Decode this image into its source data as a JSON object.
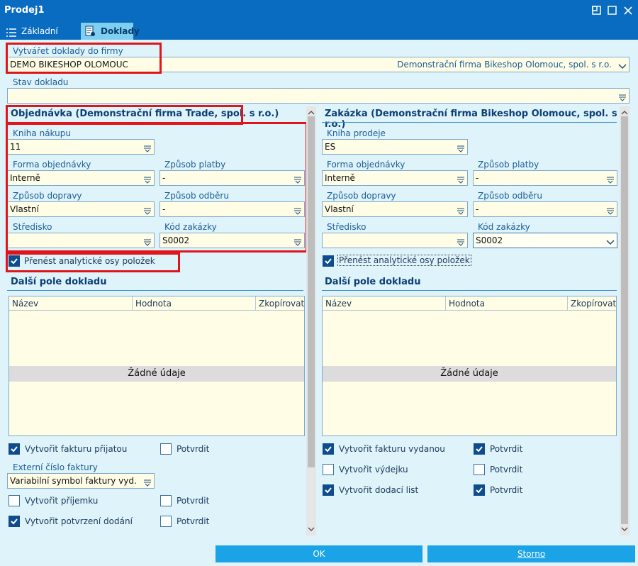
{
  "window": {
    "title": "Prodej1"
  },
  "tabs": [
    {
      "label": "Základní údaje"
    },
    {
      "label": "Doklady"
    }
  ],
  "firm": {
    "label": "Vytvářet doklady do firmy",
    "value": "DEMO BIKESHOP OLOMOUC",
    "display": "Demonstrační firma Bikeshop Olomouc, spol. s r.o."
  },
  "status": {
    "label": "Stav dokladu",
    "value": ""
  },
  "left": {
    "title": "Objednávka (Demonstrační firma Trade, spol. s r.o.)",
    "book_label": "Kniha nákupu",
    "book_value": "11",
    "form_label": "Forma objednávky",
    "form_value": "Interně",
    "payment_label": "Způsob platby",
    "payment_value": "-",
    "transport_label": "Způsob dopravy",
    "transport_value": "Vlastní",
    "pickup_label": "Způsob odběru",
    "pickup_value": "-",
    "center_label": "Středisko",
    "center_value": "",
    "order_code_label": "Kód zakázky",
    "order_code_value": "S0002",
    "transfer_label": "Přenést analytické osy položek",
    "more_title": "Další pole dokladu",
    "col_name": "Název",
    "col_value": "Hodnota",
    "col_copy": "Zkopírovat",
    "no_data": "Žádné údaje",
    "create_invoice": "Vytvořit fakturu přijatou",
    "confirm1": "Potvrdit",
    "ext_label": "Externí číslo faktury",
    "ext_value": "Variabilní symbol faktury vyd.",
    "create_receipt": "Vytvořit příjemku",
    "confirm2": "Potvrdit",
    "create_delivery_confirm": "Vytvořit potvrzení dodání",
    "confirm3": "Potvrdit"
  },
  "right": {
    "title": "Zakázka (Demonstrační firma Bikeshop Olomouc, spol. s r.o.)",
    "book_label": "Kniha prodeje",
    "book_value": "ES",
    "form_label": "Forma objednávky",
    "form_value": "Interně",
    "payment_label": "Způsob platby",
    "payment_value": "-",
    "transport_label": "Způsob dopravy",
    "transport_value": "Vlastní",
    "pickup_label": "Způsob odběru",
    "pickup_value": "-",
    "center_label": "Středisko",
    "center_value": "",
    "order_code_label": "Kód zakázky",
    "order_code_value": "S0002",
    "transfer_label": "Přenést analytické osy položek",
    "more_title": "Další pole dokladu",
    "col_name": "Název",
    "col_value": "Hodnota",
    "col_copy": "Zkopírovat",
    "no_data": "Žádné údaje",
    "create_invoice": "Vytvořit fakturu vydanou",
    "confirm1": "Potvrdit",
    "create_issue": "Vytvořit výdejku",
    "confirm2": "Potvrdit",
    "create_delivery_note": "Vytvořit dodací list",
    "confirm3": "Potvrdit"
  },
  "buttons": {
    "ok": "OK",
    "cancel": "Storno"
  },
  "colors": {
    "titlebar": "#0a6cc0",
    "accent": "#1aa3e6",
    "highlight": "#e0151b",
    "field_bg": "#fffde6"
  }
}
